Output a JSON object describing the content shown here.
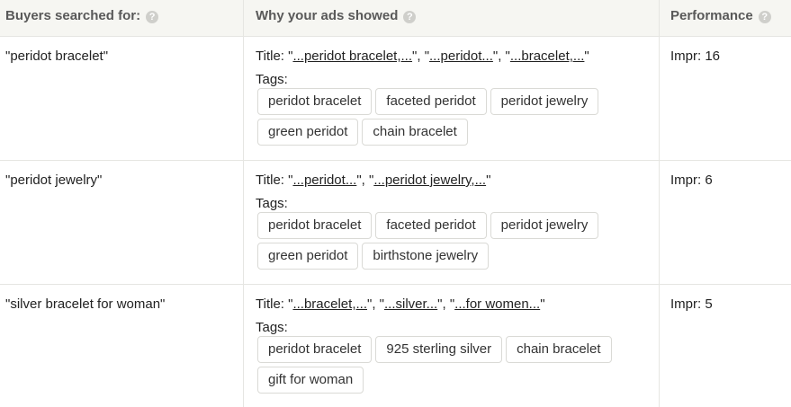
{
  "header": {
    "col1": "Buyers searched for:",
    "col2": "Why your ads showed",
    "col3": "Performance",
    "help_icon": "?"
  },
  "rows": [
    {
      "query": "\"peridot bracelet\"",
      "title_prefix": "Title: \"",
      "title_parts": [
        {
          "text": "...peridot bracelet,...",
          "sep": "\", \""
        },
        {
          "text": "...peridot...",
          "sep": "\", \""
        },
        {
          "text": "...bracelet,...",
          "sep": "\""
        }
      ],
      "tags_label": "Tags:",
      "tags": [
        "peridot bracelet",
        "faceted peridot",
        "peridot jewelry",
        "green peridot",
        "chain bracelet"
      ],
      "performance": "Impr: 16"
    },
    {
      "query": "\"peridot jewelry\"",
      "title_prefix": "Title: \"",
      "title_parts": [
        {
          "text": "...peridot...",
          "sep": "\", \""
        },
        {
          "text": "...peridot jewelry,...",
          "sep": "\""
        }
      ],
      "tags_label": "Tags:",
      "tags": [
        "peridot bracelet",
        "faceted peridot",
        "peridot jewelry",
        "green peridot",
        "birthstone jewelry"
      ],
      "performance": "Impr: 6"
    },
    {
      "query": "\"silver bracelet for woman\"",
      "title_prefix": "Title: \"",
      "title_parts": [
        {
          "text": "...bracelet,...",
          "sep": "\", \""
        },
        {
          "text": "...silver...",
          "sep": "\", \""
        },
        {
          "text": "...for women...",
          "sep": "\""
        }
      ],
      "tags_label": "Tags:",
      "tags": [
        "peridot bracelet",
        "925 sterling silver",
        "chain bracelet",
        "gift for woman"
      ],
      "performance": "Impr: 5"
    }
  ]
}
